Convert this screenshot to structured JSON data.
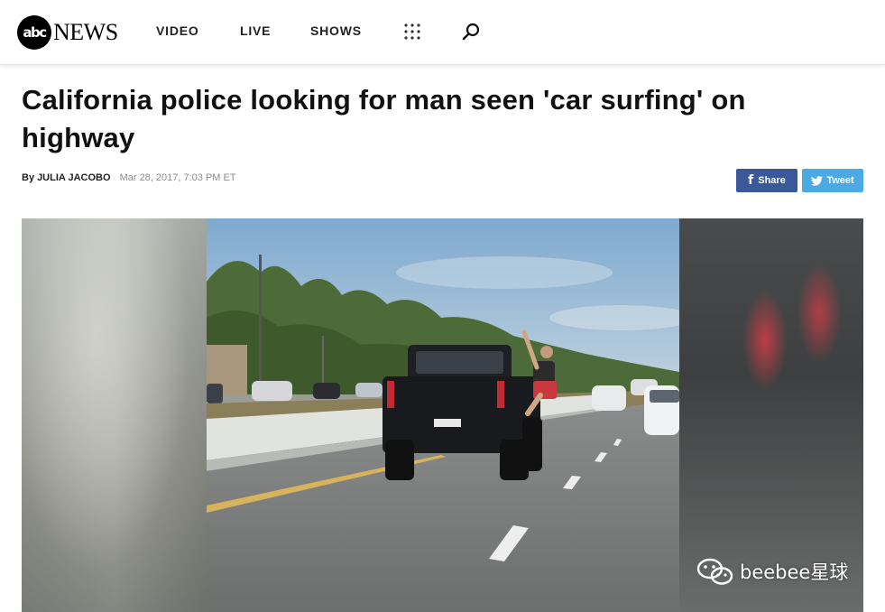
{
  "header": {
    "logo": {
      "abc": "abc",
      "news": "NEWS"
    },
    "nav": [
      {
        "label": "VIDEO"
      },
      {
        "label": "LIVE"
      },
      {
        "label": "SHOWS"
      }
    ],
    "icons": [
      "grid-icon",
      "search-icon"
    ]
  },
  "article": {
    "headline": "California police looking for man seen 'car surfing' on highway",
    "byline": {
      "prefix": "By",
      "author": "JULIA JACOBO",
      "timestamp": "Mar 28, 2017, 7:03 PM ET"
    },
    "share": {
      "facebook_label": "Share",
      "twitter_label": "Tweet"
    }
  },
  "media": {
    "description_icon": "highway-photo",
    "watermark": "beebee星球"
  },
  "colors": {
    "facebook": "#3b5998",
    "twitter": "#4ba9e3",
    "text": "#111111",
    "muted": "#8c8c8c"
  }
}
